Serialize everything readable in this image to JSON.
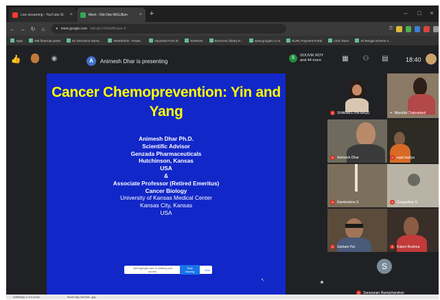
{
  "browser": {
    "tabs": [
      {
        "label": "Live streaming - YouTube St",
        "favicon_color": "#ff3b30"
      },
      {
        "label": "Meet - Okt-Otw-WGUlbxn",
        "favicon_color": "#34a853"
      }
    ],
    "new_tab_icon": "plus-icon",
    "url_host": "meet.google.com",
    "url_rest": "/wtt-djrn-hhkfwtfhuser-0",
    "bookmarks": [
      "Apps",
      "WB financial portal",
      "Sri Geronimo Name...",
      "WestWinds - Power...",
      "Imported From IE",
      "SeeMore",
      "Electronic library D...",
      "www.googlex.co.in",
      "EURL Payment Portal",
      "OCD Store",
      "All Bengal scheme s..."
    ]
  },
  "meet": {
    "presenter_initial": "A",
    "presenter_text": "Animesh Dhar is presenting",
    "people_initial": "S",
    "people_name": "SOUVIK ROY",
    "people_more": "and 44 more",
    "clock": "18:40"
  },
  "slide": {
    "title_line1": "Cancer Chemoprevention: Yin and",
    "title_line2": "Yang",
    "lines": [
      "Animesh Dhar Ph.D.",
      "Scientific Advisor",
      "Genzada Pharmaceuticals",
      "Hutchinson, Kansas",
      "USA",
      "&",
      "Associate Professor (Retired Emeritus)",
      "Cancer Biology",
      "University of Kansas Medical Center",
      "Kansas City, Kansas",
      "USA"
    ],
    "share_bar_text": "meet.google.com is sharing your screen.",
    "share_stop": "Stop sharing",
    "share_hide": "Hide"
  },
  "participants": {
    "sb": "SHARMISTHA BASU",
    "nb": "Nibedita Chakrabarti",
    "ad": "Animesh Dhar",
    "rb": "rajat baidya",
    "rs": "Ramkrishna S",
    "gs": "Gangadhar G",
    "sp": "Sarbani Pal",
    "kb": "Kaberi Brahma",
    "sr": "Saravanan Ramachandran",
    "sr_initial": "S"
  },
  "shelf": {
    "item1": "SoftSetup-1.3.0.4.exe",
    "item2": "Short-Clip-YouTub...jpg"
  },
  "colors": {
    "slide_bg": "#1227c8",
    "slide_title": "#ffff00",
    "meet_bg": "#202124",
    "mic_off": "#d93025"
  }
}
